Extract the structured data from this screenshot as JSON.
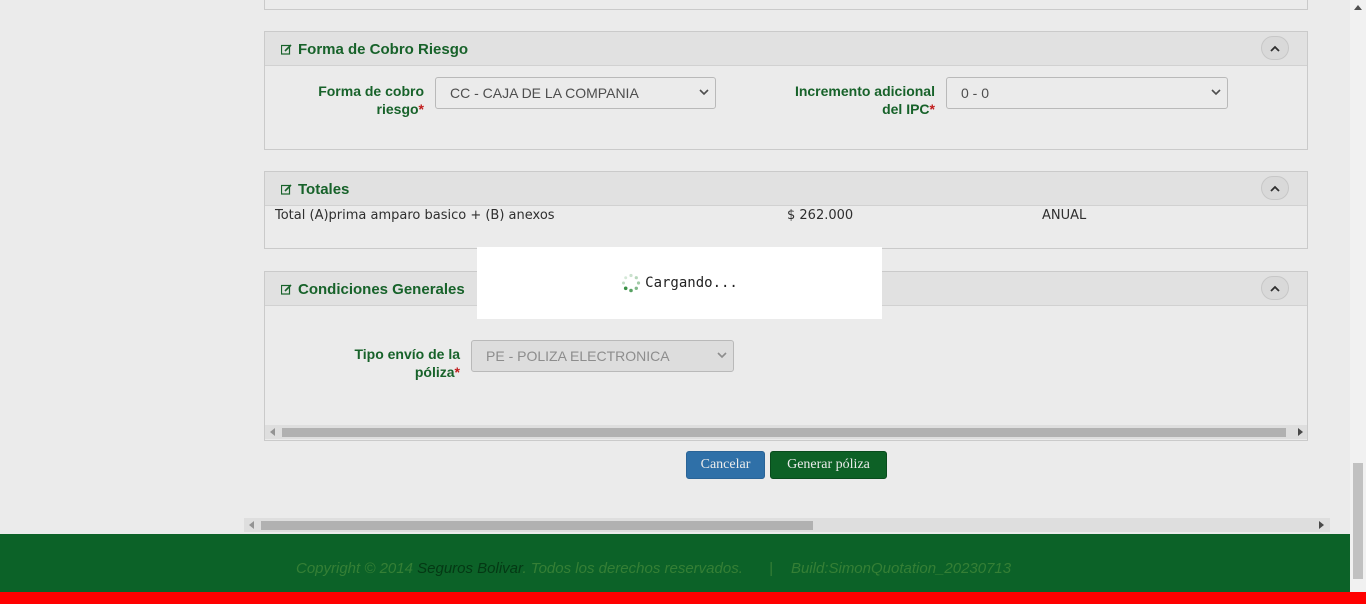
{
  "sections": {
    "forma_cobro": {
      "title": "Forma de Cobro Riesgo",
      "field1_label": "Forma de cobro riesgo",
      "field1_value": "CC - CAJA DE LA COMPANIA",
      "field2_label": "Incremento adicional del IPC",
      "field2_value": "0 - 0"
    },
    "totales": {
      "title": "Totales",
      "row_label": "Total (A)prima amparo basico + (B) anexos",
      "row_amount": "$ 262.000",
      "row_period": "ANUAL"
    },
    "condiciones": {
      "title": "Condiciones Generales",
      "field_label": "Tipo envío de la póliza",
      "field_value": "PE - POLIZA ELECTRONICA"
    }
  },
  "required_marker": "*",
  "buttons": {
    "cancel": "Cancelar",
    "generate": "Generar póliza"
  },
  "footer": {
    "copyright_prefix": "Copyright © 2014 ",
    "brand": "Seguros Bolivar",
    "rights": ". Todos los derechos reservados.",
    "separator": "|",
    "build": "Build:SimonQuotation_20230713"
  },
  "loading": {
    "text": "Cargando..."
  },
  "colors": {
    "accent_green": "#1a6b2e",
    "footer_green": "#0e6b2c",
    "alert_red": "#ff0000",
    "cancel_blue": "#337ab7"
  }
}
